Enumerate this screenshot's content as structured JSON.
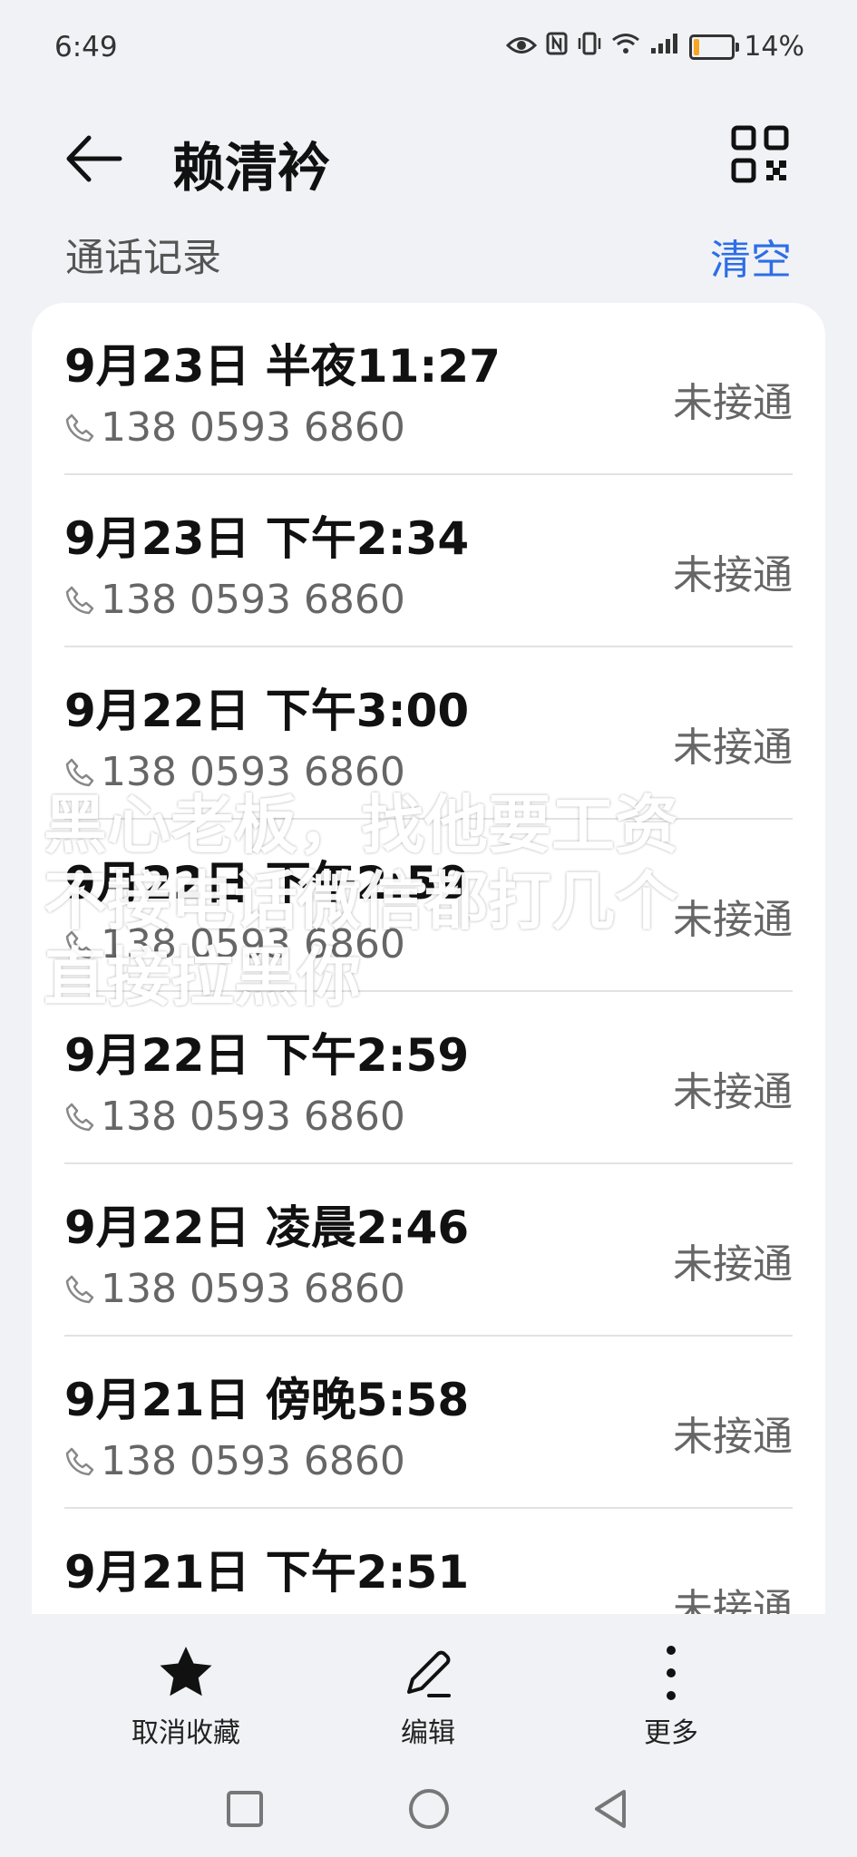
{
  "status_bar": {
    "time": "6:49",
    "battery": "14%",
    "battery_level": 0.14
  },
  "header": {
    "title": "赖清衿"
  },
  "section": {
    "title": "通话记录",
    "clear_label": "清空"
  },
  "calls": [
    {
      "date": "9月23日 半夜11:27",
      "phone": "138 0593 6860",
      "status": "未接通"
    },
    {
      "date": "9月23日 下午2:34",
      "phone": "138 0593 6860",
      "status": "未接通"
    },
    {
      "date": "9月22日 下午3:00",
      "phone": "138 0593 6860",
      "status": "未接通"
    },
    {
      "date": "9月22日 下午2:59",
      "phone": "138 0593 6860",
      "status": "未接通"
    },
    {
      "date": "9月22日 下午2:59",
      "phone": "138 0593 6860",
      "status": "未接通"
    },
    {
      "date": "9月22日 凌晨2:46",
      "phone": "138 0593 6860",
      "status": "未接通"
    },
    {
      "date": "9月21日 傍晚5:58",
      "phone": "138 0593 6860",
      "status": "未接通"
    },
    {
      "date": "9月21日 下午2:51",
      "phone": "",
      "status": "未接通"
    }
  ],
  "overlay_text": [
    "黑心老板，找他要工资",
    "不接电话微信都打几个",
    "直接拉黑你"
  ],
  "bottom_actions": {
    "unfavorite": "取消收藏",
    "edit": "编辑",
    "more": "更多"
  },
  "colors": {
    "accent": "#2d6ee6",
    "background": "#f1f2f6",
    "battery": "#f5a623"
  }
}
